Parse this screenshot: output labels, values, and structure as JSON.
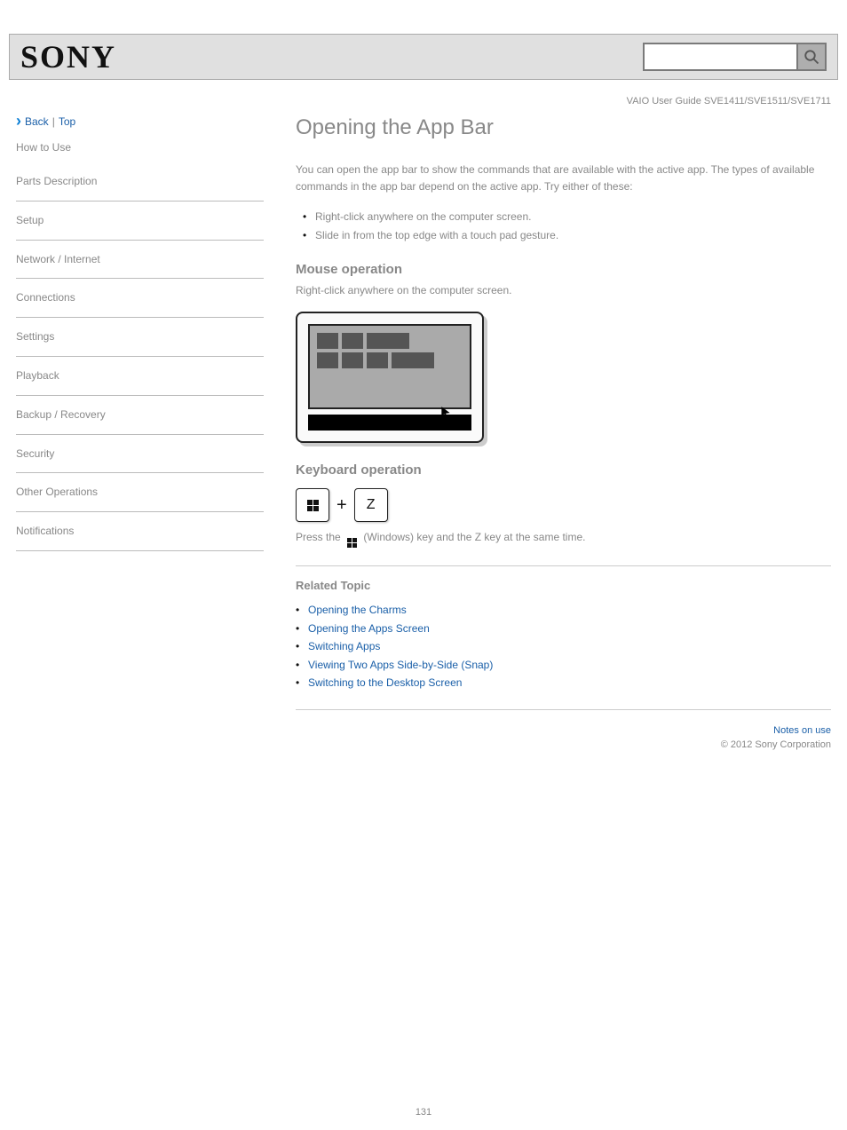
{
  "header": {
    "logo": "SONY",
    "search_placeholder": ""
  },
  "model": "VAIO User Guide   SVE1411/SVE1511/SVE1711",
  "breadcrumb_back": "Back",
  "breadcrumb_top": "Top",
  "sidebar": {
    "items": [
      "Parts Description",
      "Setup",
      "Network / Internet",
      "Connections",
      "Settings",
      "Playback",
      "Backup / Recovery",
      "Security",
      "Other Operations",
      "Notifications"
    ]
  },
  "main": {
    "category": "How to Use",
    "title": "Opening the App Bar",
    "intro": "You can open the app bar to show the commands that are available with the active app. The types of available commands in the app bar depend on the active app. Try either of these:",
    "bullets": [
      "Right-click anywhere on the computer screen.",
      "Slide in from the top edge with a touch pad gesture."
    ],
    "mouse_heading": "Mouse operation",
    "mouse_body": "Right-click anywhere on the computer screen.",
    "kb_heading": "Keyboard operation",
    "kb_body1": "Press the ",
    "kb_body2": " (Windows) key and the Z key at the same time.",
    "related_heading": "Related Topic",
    "related_links": [
      "Opening the Charms",
      "Opening the Apps Screen",
      "Switching Apps",
      "Viewing Two Apps Side-by-Side (Snap)",
      "Switching to the Desktop Screen"
    ],
    "notes_heading": "Notes on use",
    "copyright": "© 2012 Sony Corporation"
  },
  "page_number": "131"
}
